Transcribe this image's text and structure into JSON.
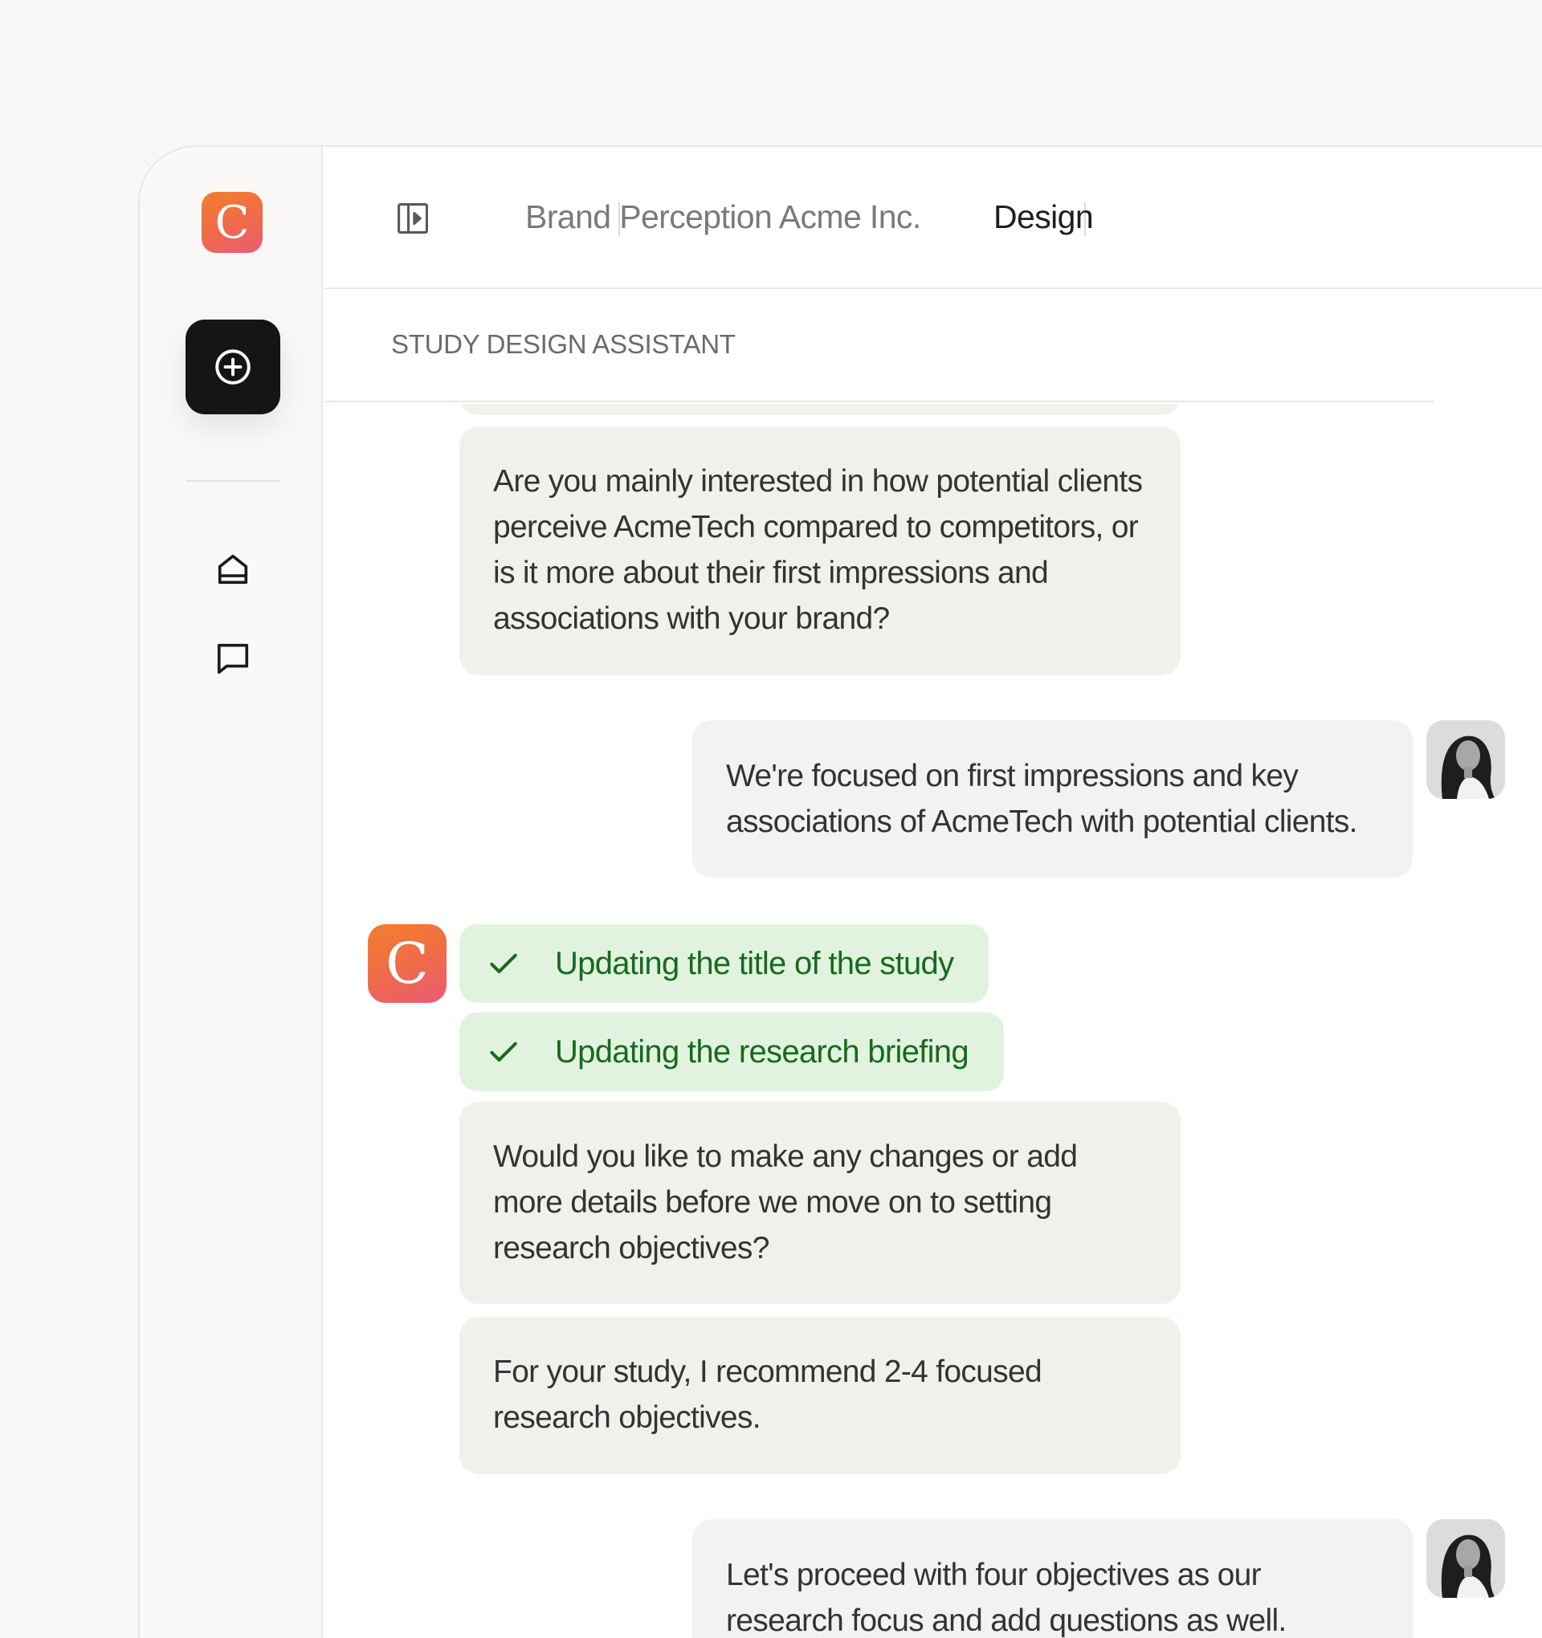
{
  "sidebar": {
    "logo_letter": "C",
    "new_button_icon": "plus-circle-icon",
    "nav": [
      {
        "icon": "home-icon"
      },
      {
        "icon": "chat-icon"
      }
    ]
  },
  "topbar": {
    "panel_icon": "sidebar-toggle-icon",
    "breadcrumb": {
      "project": "Brand Perception Acme Inc.",
      "page": "Design"
    }
  },
  "assistant": {
    "title": "STUDY DESIGN ASSISTANT",
    "avatar_letter": "C"
  },
  "messages": [
    {
      "role": "assistant",
      "text": "Are you mainly interested in how potential clients perceive AcmeTech compared to competitors, or is it more about their first impressions and associations with your brand?"
    },
    {
      "role": "user",
      "text": "We're focused on first impressions and key associations of AcmeTech with potential clients."
    },
    {
      "role": "status",
      "text": "Updating the title of the study"
    },
    {
      "role": "status",
      "text": "Updating the research briefing"
    },
    {
      "role": "assistant",
      "text": "Would you like to make any changes or add more details before we move on to setting research objectives?"
    },
    {
      "role": "assistant",
      "text": "For your study, I recommend 2-4 focused research objectives."
    },
    {
      "role": "user",
      "text": "Let's proceed with four objectives as our research focus and add questions as well."
    }
  ],
  "colors": {
    "accent_gradient_start": "#f27e2e",
    "accent_gradient_end": "#ea5c77",
    "status_bg": "#e1f3df",
    "status_text": "#176a1c",
    "assistant_bubble": "#f2f0ec",
    "user_bubble": "#f2f2f2"
  }
}
